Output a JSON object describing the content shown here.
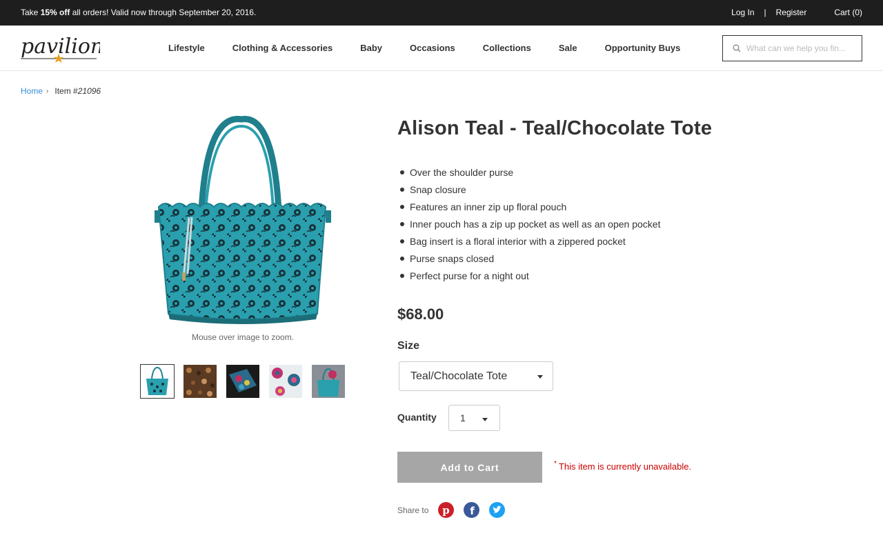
{
  "promo": {
    "prefix": "Take ",
    "bold": "15% off",
    "suffix": " all orders! Valid now through September 20, 2016.",
    "login": "Log In",
    "separator": "|",
    "register": "Register",
    "cart": "Cart (0)"
  },
  "header": {
    "logo_text": "pavilion",
    "nav": [
      "Lifestyle",
      "Clothing & Accessories",
      "Baby",
      "Occasions",
      "Collections",
      "Sale",
      "Opportunity Buys"
    ],
    "search_placeholder": "What can we help you fin...",
    "search_icon": "search-icon"
  },
  "breadcrumb": {
    "home": "Home",
    "item_prefix": "Item #",
    "item_number": "21096"
  },
  "gallery": {
    "zoom_hint": "Mouse over image to zoom.",
    "thumbnail_count": 5
  },
  "product": {
    "title": "Alison Teal - Teal/Chocolate Tote",
    "features": [
      "Over the shoulder purse",
      "Snap closure",
      "Features an inner zip up floral pouch",
      "Inner pouch has a zip up pocket as well as an open pocket",
      "Bag insert is a floral interior with a zippered pocket",
      "Purse snaps closed",
      "Perfect purse for a night out"
    ],
    "price": "$68.00",
    "size_label": "Size",
    "size_value": "Teal/Chocolate Tote",
    "quantity_label": "Quantity",
    "quantity_value": "1",
    "add_to_cart": "Add to Cart",
    "unavailable_mark": "*",
    "unavailable_text": "This item is currently unavailable.",
    "share_label": "Share to"
  },
  "colors": {
    "promo_bg": "#1e1e1e",
    "link_blue": "#3a8fd6",
    "teal": "#2a9fae",
    "button_disabled": "#a6a6a6",
    "error_red": "#cc0000",
    "pinterest": "#cb2027",
    "facebook": "#3b5998",
    "twitter": "#1da1f2"
  }
}
